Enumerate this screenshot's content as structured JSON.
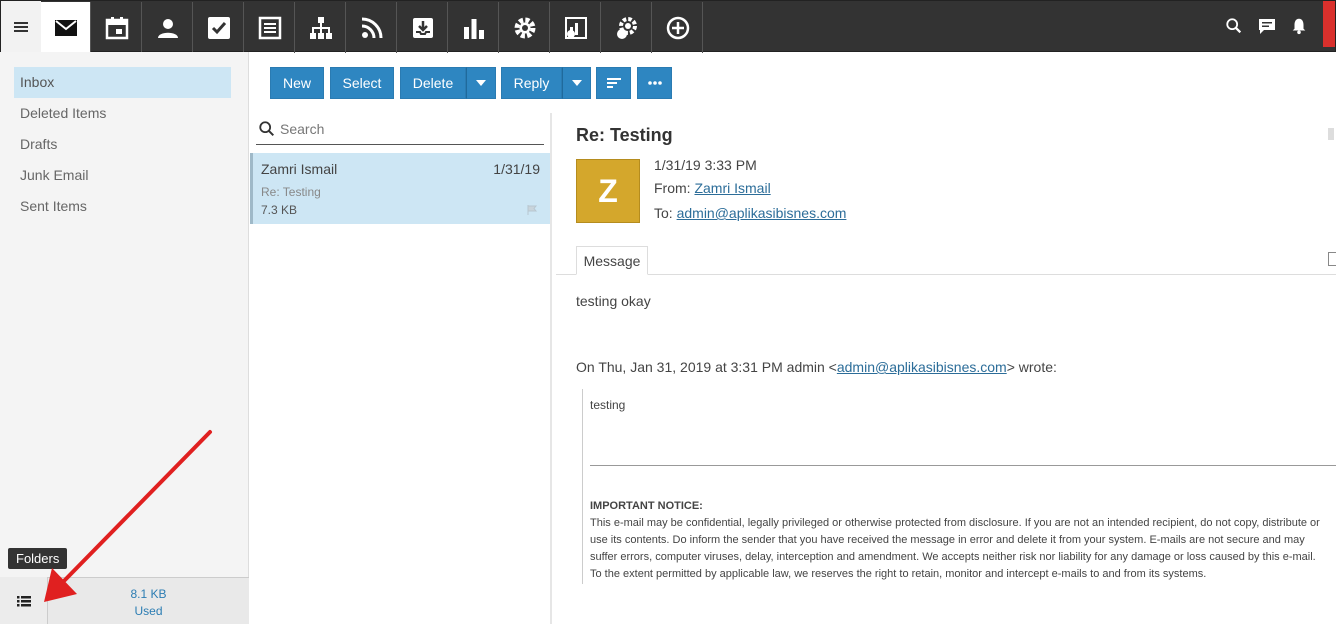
{
  "topbar": {
    "apps": [
      {
        "name": "mail-icon",
        "active": true
      },
      {
        "name": "calendar-icon"
      },
      {
        "name": "contacts-icon"
      },
      {
        "name": "tasks-icon"
      },
      {
        "name": "notes-icon"
      },
      {
        "name": "org-chart-icon"
      },
      {
        "name": "rss-icon"
      },
      {
        "name": "inbox-download-icon"
      },
      {
        "name": "bar-chart-icon"
      },
      {
        "name": "settings-icon"
      },
      {
        "name": "reports-icon"
      },
      {
        "name": "domain-settings-icon"
      },
      {
        "name": "add-icon"
      }
    ],
    "right_icons": [
      "search-icon",
      "chat-icon",
      "bell-icon"
    ]
  },
  "folders": {
    "items": [
      {
        "label": "Inbox",
        "active": true
      },
      {
        "label": "Deleted Items"
      },
      {
        "label": "Drafts"
      },
      {
        "label": "Junk Email"
      },
      {
        "label": "Sent Items"
      }
    ],
    "tooltip": "Folders",
    "storage_value": "8.1 KB",
    "storage_label": "Used"
  },
  "toolbar": {
    "new_label": "New",
    "select_label": "Select",
    "delete_label": "Delete",
    "reply_label": "Reply"
  },
  "list": {
    "search_placeholder": "Search",
    "messages": [
      {
        "sender": "Zamri Ismail",
        "date": "1/31/19",
        "subject": "Re: Testing",
        "size": "7.3 KB"
      }
    ]
  },
  "reading": {
    "subject": "Re: Testing",
    "avatar_letter": "Z",
    "datetime": "1/31/19 3:33 PM",
    "from_label": "From:",
    "from_name": "Zamri Ismail",
    "to_label": "To:",
    "to_address": "admin@aplikasibisnes.com",
    "tab_label": "Message",
    "body_line": "testing okay",
    "quote_header_prefix": "On Thu, Jan 31, 2019 at 3:31 PM admin <",
    "quote_header_email": "admin@aplikasibisnes.com",
    "quote_header_suffix": "> wrote:",
    "quote_text": "testing",
    "notice_title": "IMPORTANT NOTICE:",
    "notice_body": "This e-mail may be confidential, legally privileged or otherwise protected from disclosure. If you are not an intended recipient, do not copy, distribute or use its contents. Do inform the sender that you have received the message in error and delete it from your system. E-mails are not secure and may suffer errors, computer viruses, delay, interception and amendment. We accepts neither risk nor liability for any damage or loss caused by this e-mail. To the extent permitted by applicable law, we reserves the right to retain, monitor and intercept e-mails to and from its systems."
  },
  "colors": {
    "accent": "#2e86c1",
    "selected_bg": "#cde6f4",
    "topbar_bg": "#333333",
    "avatar_bg": "#d4a72c",
    "annotation_arrow": "#e02020"
  }
}
